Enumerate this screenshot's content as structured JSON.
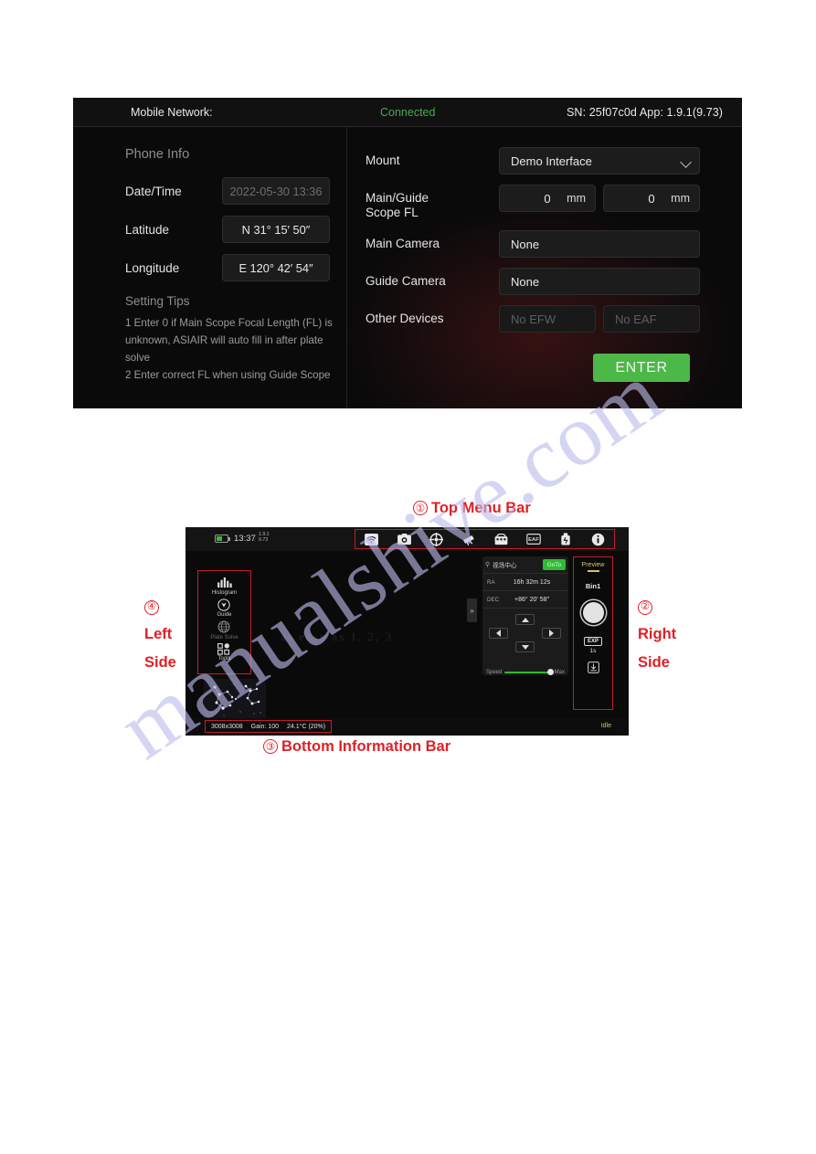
{
  "watermark": "manualshive.com",
  "top_screenshot": {
    "statusbar": {
      "network_label": "Mobile Network:",
      "connection_status": "Connected",
      "serial_and_app": "SN: 25f07c0d   App: 1.9.1(9.73)",
      "connected_color": "#4ea64e"
    },
    "left_panel": {
      "section_title": "Phone Info",
      "rows": [
        {
          "label": "Date/Time",
          "value": "2022-05-30 13:36",
          "muted": true
        },
        {
          "label": "Latitude",
          "value": "N 31° 15′ 50″",
          "muted": false
        },
        {
          "label": "Longitude",
          "value": "E 120° 42′ 54″",
          "muted": false
        }
      ],
      "tips_title": "Setting Tips",
      "tips_body": "1 Enter 0 if Main Scope Focal Length (FL) is unknown, ASIAIR will auto fill in after plate solve\n2 Enter correct FL when using Guide Scope"
    },
    "right_panel": {
      "mount_label": "Mount",
      "mount_value": "Demo Interface",
      "fl_label": "Main/Guide\nScope FL",
      "fl_main_value": "0",
      "fl_main_unit": "mm",
      "fl_guide_value": "0",
      "fl_guide_unit": "mm",
      "main_camera_label": "Main Camera",
      "main_camera_value": "None",
      "guide_camera_label": "Guide Camera",
      "guide_camera_value": "None",
      "other_devices_label": "Other Devices",
      "efw_placeholder": "No EFW",
      "eaf_placeholder": "No EAF",
      "enter_label": "ENTER",
      "enter_color": "#4cb847"
    }
  },
  "annotations": {
    "color": "#e01f26",
    "top_menu": {
      "number": "①",
      "text": "Top Menu Bar"
    },
    "right_side": {
      "number": "②",
      "line1": "Right",
      "line2": "Side"
    },
    "bottom_info": {
      "number": "③",
      "text": "Bottom Information Bar"
    },
    "left_side": {
      "number": "④",
      "line1": "Left",
      "line2": "Side"
    }
  },
  "app_screenshot": {
    "top_bar": {
      "clock": "13:37",
      "version_line1": "1.9.1",
      "version_line2": "9.73",
      "icons": [
        "wifi-icon",
        "camera-icon",
        "target-icon",
        "telescope-icon",
        "mount-icon",
        "eaf-icon",
        "usb-icon",
        "info-icon"
      ]
    },
    "left_side_tools": [
      {
        "label": "Histogram",
        "icon": "histogram-icon",
        "dim": false
      },
      {
        "label": "Guide",
        "icon": "guide-icon",
        "dim": false
      },
      {
        "label": "Plate Solve",
        "icon": "plate-solve-icon",
        "dim": true
      },
      {
        "label": "Tools",
        "icon": "tools-icon",
        "dim": false
      }
    ],
    "sky_overlay_text": "as easy as 1, 2, 3",
    "goto_panel": {
      "search_placeholder": "视场中心",
      "goto_button": "GoTo",
      "goto_button_color": "#2fbc34",
      "ra_label": "RA",
      "ra_value": "16h 32m 12s",
      "dec_label": "DEC",
      "dec_value": "+86° 20′ 58″",
      "speed_label": "Speed",
      "speed_max_label": "Max"
    },
    "collapse_handle": "»",
    "right_side": {
      "mode_label": "Preview",
      "mode_color": "#d8c36a",
      "bin_label": "Bin1",
      "shutter": "shutter-button",
      "exposure_badge": "EXP",
      "exposure_value": "1s",
      "save_icon": "save-icon"
    },
    "bottom_bar": {
      "resolution": "3008x3008",
      "gain": "Gain: 100",
      "temperature": "24.1°C (20%)",
      "status": "Idle",
      "status_color": "#d8c36a"
    }
  }
}
